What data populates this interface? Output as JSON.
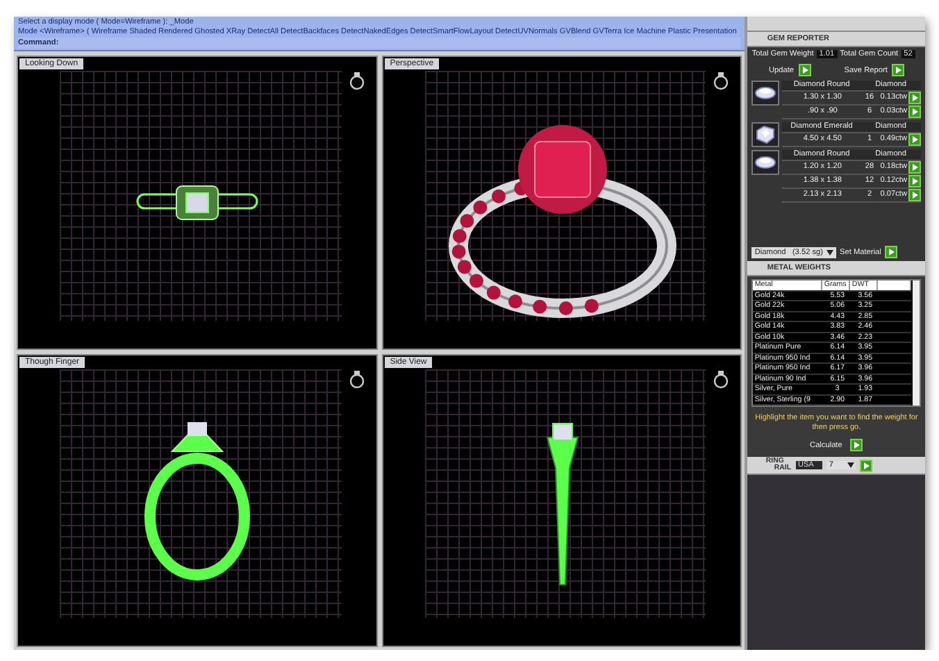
{
  "command_area": {
    "prompt": "Select a display mode ( Mode=Wireframe ): _Mode",
    "options": "Mode <Wireframe> ( Wireframe  Shaded  Rendered  Ghosted  XRay  DetectAll  DetectBackfaces  DetectNakedEdges  DetectSmartFlowLayout  DetectUVNormals  GVBlend  GVTerra  Ice  Machine  Plastic  Presentation",
    "command_label": "Command:"
  },
  "viewports": [
    {
      "title": "Looking Down",
      "kind": "top"
    },
    {
      "title": "Perspective",
      "kind": "perspective"
    },
    {
      "title": "Though Finger",
      "kind": "front"
    },
    {
      "title": "Side View",
      "kind": "side"
    }
  ],
  "gem_reporter": {
    "title": "GEM REPORTER",
    "weight_label": "Total Gem Weight",
    "weight": "1.01",
    "count_label": "Total Gem Count",
    "count": "52",
    "update": "Update",
    "save": "Save Report",
    "groups": [
      {
        "kind": "round",
        "name": "Diamond Round",
        "material": "Diamond",
        "rows": [
          {
            "size": "1.30 x 1.30",
            "count": "16",
            "ctw": "0.13ctw"
          },
          {
            "size": ".90 x .90",
            "count": "6",
            "ctw": "0.03ctw"
          }
        ]
      },
      {
        "kind": "emerald",
        "name": "Diamond Emerald",
        "material": "Diamond",
        "rows": [
          {
            "size": "4.50 x 4.50",
            "count": "1",
            "ctw": "0.49ctw"
          }
        ]
      },
      {
        "kind": "round",
        "name": "Diamond Round",
        "material": "Diamond",
        "rows": [
          {
            "size": "1.20 x 1.20",
            "count": "28",
            "ctw": "0.18ctw"
          },
          {
            "size": "1.38 x 1.38",
            "count": "12",
            "ctw": "0.12ctw"
          },
          {
            "size": "2.13 x 2.13",
            "count": "2",
            "ctw": "0.07ctw"
          }
        ]
      }
    ],
    "material": "Diamond   (3.52 sg)",
    "set_material": "Set Material"
  },
  "metal_weights": {
    "title": "METAL WEIGHTS",
    "columns": [
      "Metal",
      "Grams",
      "DWT"
    ],
    "rows": [
      {
        "metal": "Gold 24k",
        "grams": "5.53",
        "dwt": "3.56"
      },
      {
        "metal": "Gold 22k",
        "grams": "5.06",
        "dwt": "3.25"
      },
      {
        "metal": "Gold 18k",
        "grams": "4.43",
        "dwt": "2.85"
      },
      {
        "metal": "Gold 14k",
        "grams": "3.83",
        "dwt": "2.46"
      },
      {
        "metal": "Gold 10k",
        "grams": "3.46",
        "dwt": "2.23"
      },
      {
        "metal": "Platinum Pure",
        "grams": "6.14",
        "dwt": "3.95"
      },
      {
        "metal": "Platinum 950 Ind",
        "grams": "6.14",
        "dwt": "3.95"
      },
      {
        "metal": "Platinum 950 Ind",
        "grams": "6.17",
        "dwt": "3.96"
      },
      {
        "metal": "Platinum 90 Ind",
        "grams": "6.15",
        "dwt": "3.96"
      },
      {
        "metal": "Silver, Pure",
        "grams": "3",
        "dwt": "1.93"
      },
      {
        "metal": "Silver, Sterling (9",
        "grams": "2.90",
        "dwt": "1.87"
      }
    ],
    "hint": "Highlight the item you want to find the weight for then press go.",
    "calculate": "Calculate"
  },
  "ring_rail": {
    "title_top": "RING",
    "title_bottom": "RAIL",
    "standard": "USA",
    "size": "7"
  }
}
